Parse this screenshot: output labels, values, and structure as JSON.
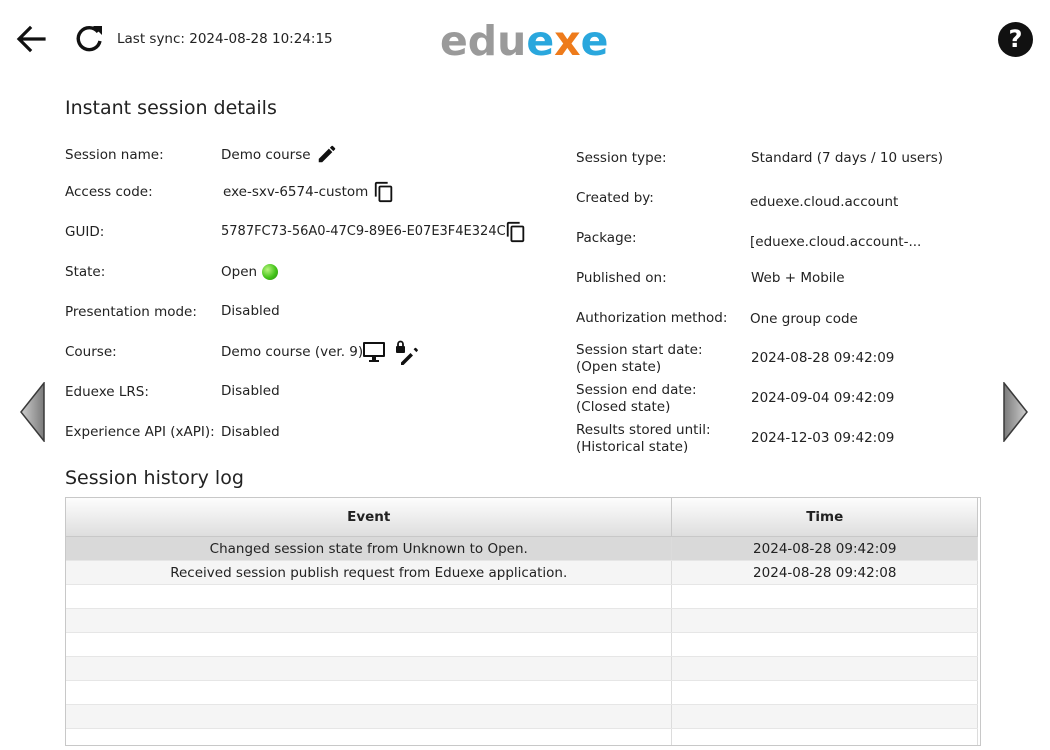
{
  "header": {
    "sync_text": "Last sync: 2024-08-28 10:24:15",
    "logo": {
      "part1": "edu",
      "part2": "x",
      "part3": "e",
      "pre": "edu",
      "e1": "e",
      "x": "x",
      "e2": "e"
    },
    "help_label": "?"
  },
  "details": {
    "title": "Instant session details",
    "session_name_label": "Session name:",
    "session_name": "Demo course",
    "access_code_label": "Access code:",
    "access_code": "exe-sxv-6574-custom",
    "guid_label": "GUID:",
    "guid": "5787FC73-56A0-47C9-89E6-E07E3F4E324C",
    "state_label": "State:",
    "state": "Open",
    "presentation_label": "Presentation mode:",
    "presentation": "Disabled",
    "course_label": "Course:",
    "course": "Demo course (ver. 9)",
    "lrs_label": "Eduexe LRS:",
    "lrs": "Disabled",
    "xapi_label": "Experience API (xAPI):",
    "xapi": "Disabled",
    "session_type_label": "Session type:",
    "session_type": "Standard (7 days / 10 users)",
    "created_by_label": "Created by:",
    "created_by": "eduexe.cloud.account",
    "package_label": "Package:",
    "package": "[eduexe.cloud.account-...",
    "published_label": "Published on:",
    "published": "Web + Mobile",
    "auth_label": "Authorization method:",
    "auth": "One group code",
    "start_label_1": "Session start date:",
    "start_label_2": "(Open state)",
    "start": "2024-08-28 09:42:09",
    "end_label_1": "Session end date:",
    "end_label_2": "(Closed state)",
    "end": "2024-09-04 09:42:09",
    "results_label_1": "Results stored until:",
    "results_label_2": "(Historical state)",
    "results": "2024-12-03 09:42:09"
  },
  "log": {
    "title": "Session history log",
    "columns": [
      "Event",
      "Time"
    ],
    "rows": [
      {
        "event": "Changed session state from Unknown to Open.",
        "time": "2024-08-28 09:42:09"
      },
      {
        "event": "Received session publish request from Eduexe application.",
        "time": "2024-08-28 09:42:08"
      }
    ]
  },
  "colors": {
    "logo_gray": "#9a9a9a",
    "logo_orange": "#ee7b1b",
    "logo_blue": "#2aa7dd",
    "state_green": "#44c41a"
  },
  "icons": [
    "back-arrow-icon",
    "refresh-icon",
    "help-icon",
    "pencil-icon",
    "copy-icon",
    "monitor-icon",
    "lock-pencil-icon",
    "chevron-left-icon",
    "chevron-right-icon"
  ]
}
